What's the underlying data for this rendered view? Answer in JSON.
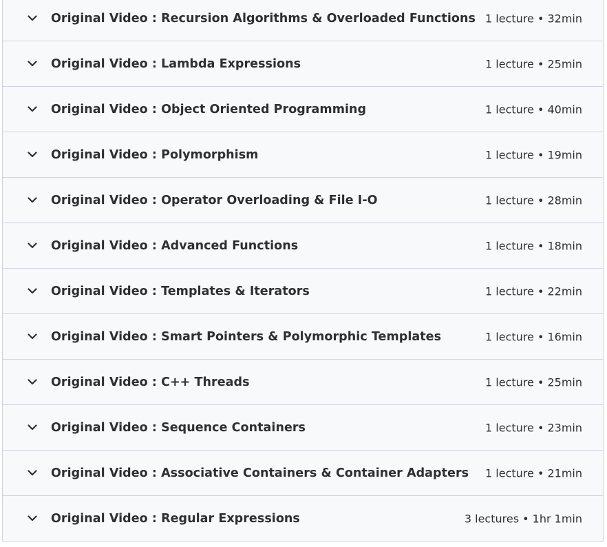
{
  "sections": [
    {
      "title": "Original Video : Recursion Algorithms & Overloaded Functions",
      "lectures": "1 lecture",
      "duration": "32min"
    },
    {
      "title": "Original Video : Lambda Expressions",
      "lectures": "1 lecture",
      "duration": "25min"
    },
    {
      "title": "Original Video : Object Oriented Programming",
      "lectures": "1 lecture",
      "duration": "40min"
    },
    {
      "title": "Original Video : Polymorphism",
      "lectures": "1 lecture",
      "duration": "19min"
    },
    {
      "title": "Original Video : Operator Overloading & File I-O",
      "lectures": "1 lecture",
      "duration": "28min"
    },
    {
      "title": "Original Video : Advanced Functions",
      "lectures": "1 lecture",
      "duration": "18min"
    },
    {
      "title": "Original Video : Templates & Iterators",
      "lectures": "1 lecture",
      "duration": "22min"
    },
    {
      "title": "Original Video : Smart Pointers & Polymorphic Templates",
      "lectures": "1 lecture",
      "duration": "16min"
    },
    {
      "title": "Original Video : C++ Threads",
      "lectures": "1 lecture",
      "duration": "25min"
    },
    {
      "title": "Original Video : Sequence Containers",
      "lectures": "1 lecture",
      "duration": "23min"
    },
    {
      "title": "Original Video : Associative Containers & Container Adapters",
      "lectures": "1 lecture",
      "duration": "21min"
    },
    {
      "title": "Original Video : Regular Expressions",
      "lectures": "3 lectures",
      "duration": "1hr 1min"
    }
  ],
  "meta_separator": " • ",
  "icons": {
    "expand": "chevron-down-icon"
  },
  "colors": {
    "row_background": "#f7f9fa",
    "border": "#d1d2e0",
    "text": "#2d2f31"
  }
}
